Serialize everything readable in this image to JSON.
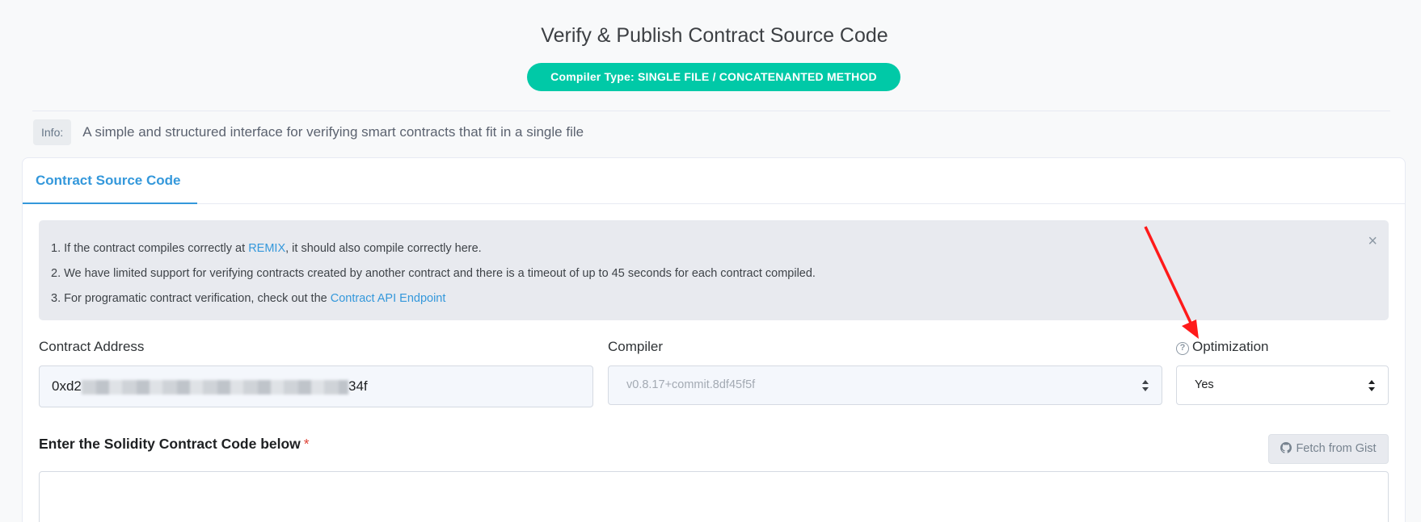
{
  "header": {
    "title": "Verify & Publish Contract Source Code",
    "badge_prefix": "Compiler Type:",
    "badge_value": "SINGLE FILE / CONCATENANTED METHOD"
  },
  "info": {
    "tag": "Info:",
    "text": "A simple and structured interface for verifying smart contracts that fit in a single file"
  },
  "tabs": [
    {
      "label": "Contract Source Code",
      "active": true
    }
  ],
  "notice": {
    "line1_prefix": "1. If the contract compiles correctly at ",
    "line1_link": "REMIX",
    "line1_suffix": ", it should also compile correctly here.",
    "line2": "2. We have limited support for verifying contracts created by another contract and there is a timeout of up to 45 seconds for each contract compiled.",
    "line3_prefix": "3. For programatic contract verification, check out the ",
    "line3_link": "Contract API Endpoint",
    "close_glyph": "×"
  },
  "form": {
    "address_label": "Contract Address",
    "address_value_start": "0xd2",
    "address_value_end": "34f",
    "compiler_label": "Compiler",
    "compiler_value": "v0.8.17+commit.8df45f5f",
    "optimization_label": "Optimization",
    "optimization_value": "Yes",
    "help_glyph": "?"
  },
  "code": {
    "label": "Enter the Solidity Contract Code below",
    "required_mark": "*",
    "gist_button": "Fetch from Gist"
  },
  "colors": {
    "accent": "#3498db",
    "badge": "#00c9a7",
    "annotation": "#ff1a1a"
  },
  "icons": {
    "help": "question-circle-icon",
    "close": "close-icon",
    "github": "github-icon",
    "sort": "sort-arrows-icon"
  }
}
